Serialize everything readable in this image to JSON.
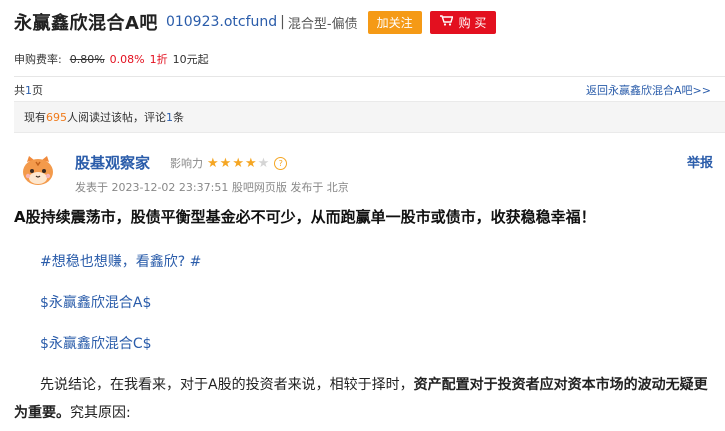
{
  "header": {
    "title": "永赢鑫欣混合A吧",
    "code": "010923.otcfund",
    "separator": "|",
    "fund_type": "混合型-偏债",
    "follow_label": "加关注",
    "buy_label": "购 买",
    "colors": {
      "follow": "#f59a16",
      "buy": "#e3101f",
      "link": "#2a5caa"
    }
  },
  "fee": {
    "label": "申购费率:",
    "original": "0.80%",
    "discounted": "0.08%",
    "discount": "1折",
    "minimum": "10元起"
  },
  "pager": {
    "prefix": "共",
    "pages": "1",
    "suffix": "页"
  },
  "back_link": "返回永赢鑫欣混合A吧>>",
  "read_stats": {
    "prefix": "现有",
    "readers": "695",
    "mid": "人阅读过该帖，评论",
    "comments": "1",
    "suffix": "条"
  },
  "post": {
    "author": "股基观察家",
    "influence_label": "影响力",
    "rating": 4,
    "rating_max": 5,
    "report_label": "举报",
    "meta": "发表于 2023-12-02 23:37:51 股吧网页版 发布于 北京",
    "headline": "A股持续震荡市，股债平衡型基金必不可少，从而跑赢单一股市或债市，收获稳稳幸福！",
    "tags": [
      "#想稳也想赚，看鑫欣? #",
      "$永赢鑫欣混合A$",
      "$永赢鑫欣混合C$"
    ],
    "para_start": "先说结论，在我看来，对于A股的投资者来说，相较于择时，",
    "para_bold": "资产配置对于投资者应对资本市场的波动无疑更为重要。",
    "para_end": "究其原因:"
  },
  "icons": [
    "cart-icon",
    "star-icon",
    "help-icon",
    "tiger-avatar-icon"
  ]
}
